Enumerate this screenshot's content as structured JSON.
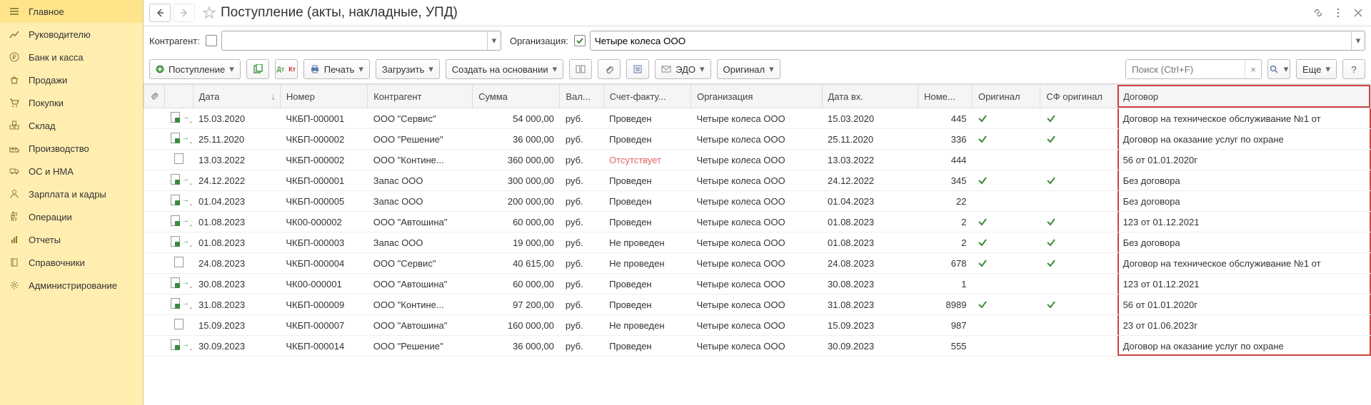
{
  "sidebar": {
    "items": [
      {
        "label": "Главное",
        "icon": "menu"
      },
      {
        "label": "Руководителю",
        "icon": "chart"
      },
      {
        "label": "Банк и касса",
        "icon": "ruble"
      },
      {
        "label": "Продажи",
        "icon": "bag"
      },
      {
        "label": "Покупки",
        "icon": "cart"
      },
      {
        "label": "Склад",
        "icon": "boxes"
      },
      {
        "label": "Производство",
        "icon": "factory"
      },
      {
        "label": "ОС и НМА",
        "icon": "truck"
      },
      {
        "label": "Зарплата и кадры",
        "icon": "person"
      },
      {
        "label": "Операции",
        "icon": "dtkt"
      },
      {
        "label": "Отчеты",
        "icon": "report"
      },
      {
        "label": "Справочники",
        "icon": "book"
      },
      {
        "label": "Администрирование",
        "icon": "gear"
      }
    ]
  },
  "title": "Поступление (акты, накладные, УПД)",
  "filter": {
    "counterparty_label": "Контрагент:",
    "counterparty_value": "",
    "counterparty_checked": false,
    "org_label": "Организация:",
    "org_value": "Четыре колеса ООО",
    "org_checked": true
  },
  "toolbar": {
    "create": "Поступление",
    "print": "Печать",
    "load": "Загрузить",
    "base": "Создать на основании",
    "edo": "ЭДО",
    "original": "Оригинал",
    "search_placeholder": "Поиск (Ctrl+F)",
    "more": "Еще"
  },
  "columns": [
    "",
    "",
    "Дата",
    "Номер",
    "Контрагент",
    "Сумма",
    "Вал...",
    "Счет-факту...",
    "Организация",
    "Дата вх.",
    "Номе...",
    "Оригинал",
    "СФ оригинал",
    "Договор"
  ],
  "rows": [
    {
      "posted": true,
      "date": "15.03.2020",
      "num": "ЧКБП-000001",
      "cp": "ООО \"Сервис\"",
      "sum": "54 000,00",
      "cur": "руб.",
      "sf": "Проведен",
      "org": "Четыре колеса ООО",
      "din": "15.03.2020",
      "nin": "445",
      "orig": true,
      "sforig": true,
      "contract": "Договор на техническое обслуживание  №1 от"
    },
    {
      "posted": true,
      "date": "25.11.2020",
      "num": "ЧКБП-000002",
      "cp": "ООО \"Решение\"",
      "sum": "36 000,00",
      "cur": "руб.",
      "sf": "Проведен",
      "org": "Четыре колеса ООО",
      "din": "25.11.2020",
      "nin": "336",
      "orig": true,
      "sforig": true,
      "contract": "Договор на оказание услуг по охране"
    },
    {
      "posted": false,
      "date": "13.03.2022",
      "num": "ЧКБП-000002",
      "cp": "ООО \"Контине...",
      "sum": "360 000,00",
      "cur": "руб.",
      "sf": "Отсутствует",
      "org": "Четыре колеса ООО",
      "din": "13.03.2022",
      "nin": "444",
      "orig": false,
      "sforig": false,
      "contract": "56 от 01.01.2020г"
    },
    {
      "posted": true,
      "date": "24.12.2022",
      "num": "ЧКБП-000001",
      "cp": "Запас ООО",
      "sum": "300 000,00",
      "cur": "руб.",
      "sf": "Проведен",
      "org": "Четыре колеса ООО",
      "din": "24.12.2022",
      "nin": "345",
      "orig": true,
      "sforig": true,
      "contract": "Без договора"
    },
    {
      "posted": true,
      "date": "01.04.2023",
      "num": "ЧКБП-000005",
      "cp": "Запас ООО",
      "sum": "200 000,00",
      "cur": "руб.",
      "sf": "Проведен",
      "org": "Четыре колеса ООО",
      "din": "01.04.2023",
      "nin": "22",
      "orig": false,
      "sforig": false,
      "contract": "Без договора"
    },
    {
      "posted": true,
      "date": "01.08.2023",
      "num": "ЧК00-000002",
      "cp": "ООО \"Автошина\"",
      "sum": "60 000,00",
      "cur": "руб.",
      "sf": "Проведен",
      "org": "Четыре колеса ООО",
      "din": "01.08.2023",
      "nin": "2",
      "orig": true,
      "sforig": true,
      "contract": "123 от 01.12.2021"
    },
    {
      "posted": true,
      "date": "01.08.2023",
      "num": "ЧКБП-000003",
      "cp": "Запас ООО",
      "sum": "19 000,00",
      "cur": "руб.",
      "sf": "Не проведен",
      "org": "Четыре колеса ООО",
      "din": "01.08.2023",
      "nin": "2",
      "orig": true,
      "sforig": true,
      "contract": "Без договора"
    },
    {
      "posted": false,
      "date": "24.08.2023",
      "num": "ЧКБП-000004",
      "cp": "ООО \"Сервис\"",
      "sum": "40 615,00",
      "cur": "руб.",
      "sf": "Не проведен",
      "org": "Четыре колеса ООО",
      "din": "24.08.2023",
      "nin": "678",
      "orig": true,
      "sforig": true,
      "contract": "Договор на техническое обслуживание  №1 от"
    },
    {
      "posted": true,
      "date": "30.08.2023",
      "num": "ЧК00-000001",
      "cp": "ООО \"Автошина\"",
      "sum": "60 000,00",
      "cur": "руб.",
      "sf": "Проведен",
      "org": "Четыре колеса ООО",
      "din": "30.08.2023",
      "nin": "1",
      "orig": false,
      "sforig": false,
      "contract": "123 от 01.12.2021"
    },
    {
      "posted": true,
      "date": "31.08.2023",
      "num": "ЧКБП-000009",
      "cp": "ООО \"Контине...",
      "sum": "97 200,00",
      "cur": "руб.",
      "sf": "Проведен",
      "org": "Четыре колеса ООО",
      "din": "31.08.2023",
      "nin": "8989",
      "orig": true,
      "sforig": true,
      "contract": "56 от 01.01.2020г"
    },
    {
      "posted": false,
      "date": "15.09.2023",
      "num": "ЧКБП-000007",
      "cp": "ООО \"Автошина\"",
      "sum": "160 000,00",
      "cur": "руб.",
      "sf": "Не проведен",
      "org": "Четыре колеса ООО",
      "din": "15.09.2023",
      "nin": "987",
      "orig": false,
      "sforig": false,
      "contract": "23 от 01.06.2023г"
    },
    {
      "posted": true,
      "date": "30.09.2023",
      "num": "ЧКБП-000014",
      "cp": "ООО \"Решение\"",
      "sum": "36 000,00",
      "cur": "руб.",
      "sf": "Проведен",
      "org": "Четыре колеса ООО",
      "din": "30.09.2023",
      "nin": "555",
      "orig": false,
      "sforig": false,
      "contract": "Договор на оказание услуг по охране"
    }
  ]
}
